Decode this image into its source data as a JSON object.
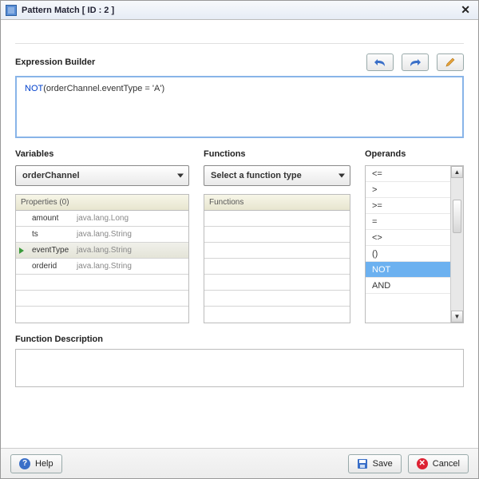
{
  "title": "Pattern Match [ ID : 2 ]",
  "sections": {
    "expression": "Expression Builder",
    "variables": "Variables",
    "functions": "Functions",
    "operands": "Operands",
    "funcdesc": "Function Description"
  },
  "expression": {
    "keyword": "NOT",
    "body": "(orderChannel.eventType = 'A')"
  },
  "variables": {
    "dropdown": "orderChannel",
    "properties_header": "Properties (0)",
    "rows": [
      {
        "name": "amount",
        "type": "java.lang.Long",
        "selected": false
      },
      {
        "name": "ts",
        "type": "java.lang.String",
        "selected": false
      },
      {
        "name": "eventType",
        "type": "java.lang.String",
        "selected": true
      },
      {
        "name": "orderid",
        "type": "java.lang.String",
        "selected": false
      },
      {
        "name": "",
        "type": "",
        "selected": false
      },
      {
        "name": "",
        "type": "",
        "selected": false
      },
      {
        "name": "",
        "type": "",
        "selected": false
      }
    ]
  },
  "functions": {
    "dropdown": "Select a function type",
    "header": "Functions",
    "rows": [
      "",
      "",
      "",
      "",
      "",
      "",
      ""
    ]
  },
  "operands": {
    "items": [
      {
        "label": "<=",
        "selected": false
      },
      {
        "label": ">",
        "selected": false
      },
      {
        "label": ">=",
        "selected": false
      },
      {
        "label": "=",
        "selected": false
      },
      {
        "label": "<>",
        "selected": false
      },
      {
        "label": "()",
        "selected": false
      },
      {
        "label": "NOT",
        "selected": true
      },
      {
        "label": "AND",
        "selected": false
      }
    ]
  },
  "footer": {
    "help": "Help",
    "save": "Save",
    "cancel": "Cancel"
  }
}
